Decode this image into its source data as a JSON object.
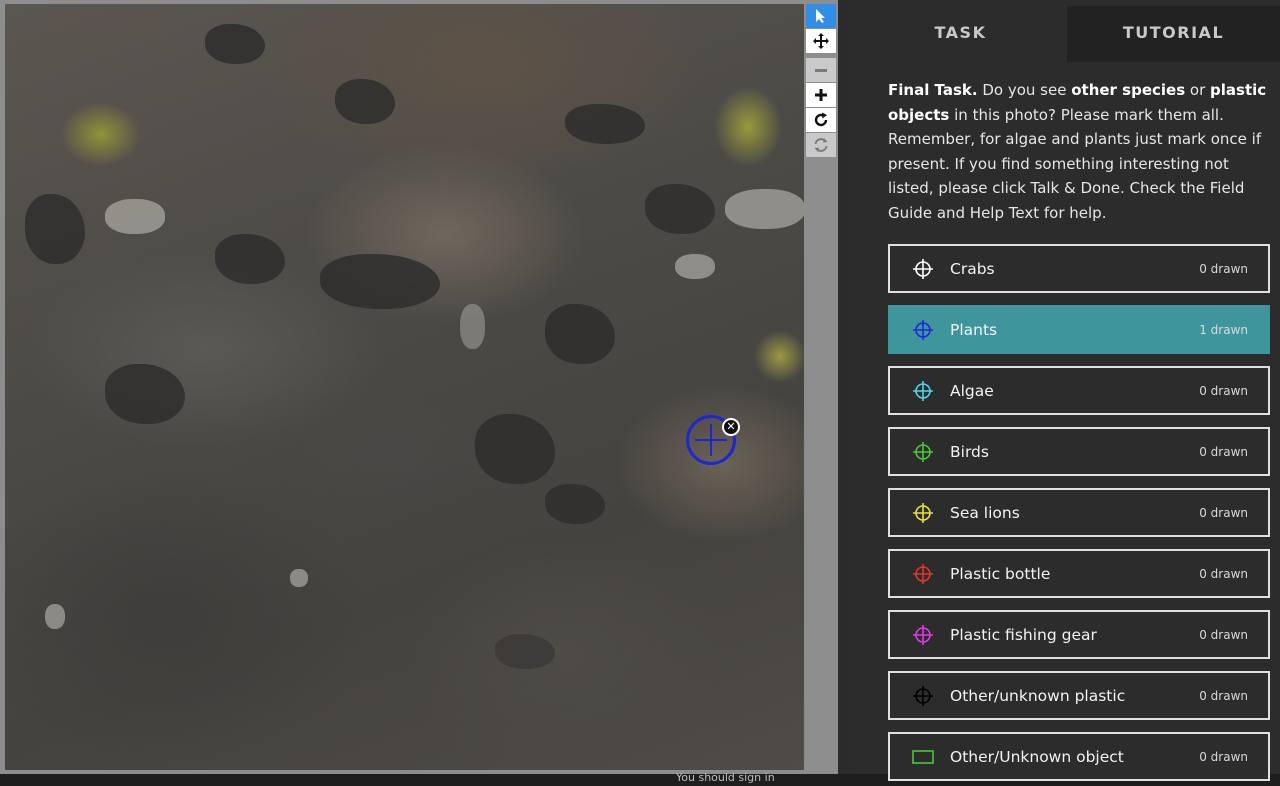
{
  "toolbar": {
    "select_icon": "pointer-icon",
    "pan_icon": "move-icon",
    "zoom_out_icon": "minus-icon",
    "zoom_in_icon": "plus-icon",
    "rotate_icon": "rotate-icon",
    "reset_icon": "reset-icon"
  },
  "statusbar": {
    "hint": "You should sign in"
  },
  "tabs": [
    {
      "label": "TASK",
      "active": true
    },
    {
      "label": "TUTORIAL",
      "active": false
    }
  ],
  "instructions": {
    "lead": "Final Task.",
    "part1": " Do you see ",
    "bold1": "other species",
    "part2": " or ",
    "bold2": "plastic objects",
    "part3": " in this photo? Please mark them all. Remember, for algae and plants just mark once if present. If you find something interesting not listed, please click Talk & Done. Check the Field Guide and Help Text for help."
  },
  "options": [
    {
      "label": "Crabs",
      "count": "0 drawn",
      "color": "#ffffff",
      "shape": "crosshair",
      "selected": false
    },
    {
      "label": "Plants",
      "count": "1 drawn",
      "color": "#1e26d6",
      "shape": "crosshair",
      "selected": true
    },
    {
      "label": "Algae",
      "count": "0 drawn",
      "color": "#4fd6e6",
      "shape": "crosshair",
      "selected": false
    },
    {
      "label": "Birds",
      "count": "0 drawn",
      "color": "#46c93a",
      "shape": "crosshair",
      "selected": false
    },
    {
      "label": "Sea lions",
      "count": "0 drawn",
      "color": "#e8e23a",
      "shape": "crosshair",
      "selected": false
    },
    {
      "label": "Plastic bottle",
      "count": "0 drawn",
      "color": "#e0392b",
      "shape": "crosshair",
      "selected": false
    },
    {
      "label": "Plastic fishing gear",
      "count": "0 drawn",
      "color": "#e23ae0",
      "shape": "crosshair",
      "selected": false
    },
    {
      "label": "Other/unknown plastic",
      "count": "0 drawn",
      "color": "#000000",
      "shape": "crosshair",
      "selected": false
    },
    {
      "label": "Other/Unknown object",
      "count": "0 drawn",
      "color": "#46c93a",
      "shape": "rectangle",
      "selected": false
    }
  ],
  "marker": {
    "tool": "Plants",
    "color": "#1e26d6",
    "delete_icon": "close-circle-icon"
  }
}
